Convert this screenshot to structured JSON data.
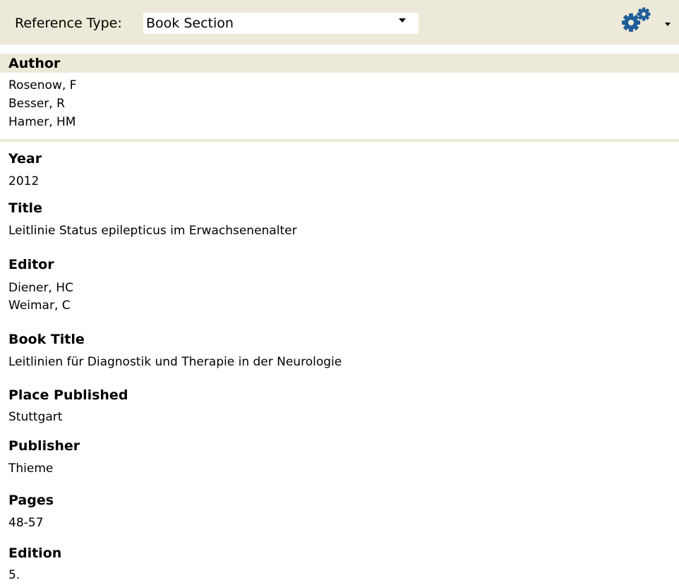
{
  "toolbar": {
    "reference_type_label": "Reference Type:",
    "reference_type_value": "Book Section",
    "gear_icon": "gears-icon",
    "accent_color": "#1f5d99"
  },
  "fields": {
    "author": {
      "label": "Author",
      "values": [
        "Rosenow, F",
        "Besser, R",
        "Hamer, HM"
      ]
    },
    "year": {
      "label": "Year",
      "value": "2012"
    },
    "title": {
      "label": "Title",
      "value": "Leitlinie Status epilepticus im Erwachsenenalter"
    },
    "editor": {
      "label": "Editor",
      "values": [
        "Diener, HC",
        "Weimar, C"
      ]
    },
    "book_title": {
      "label": "Book Title",
      "value": "Leitlinien für Diagnostik und Therapie in der Neurologie"
    },
    "place_published": {
      "label": "Place Published",
      "value": "Stuttgart"
    },
    "publisher": {
      "label": "Publisher",
      "value": "Thieme"
    },
    "pages": {
      "label": "Pages",
      "value": "48-57"
    },
    "edition": {
      "label": "Edition",
      "value": "5."
    }
  }
}
